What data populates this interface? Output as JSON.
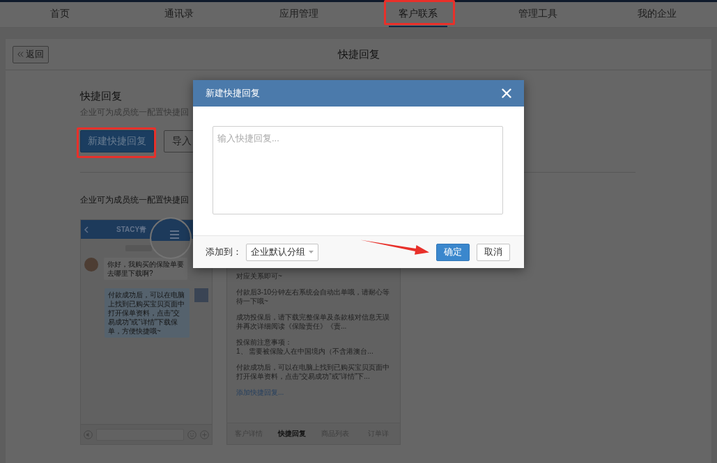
{
  "nav": {
    "items": [
      {
        "label": "首页",
        "selected": false,
        "marked": false
      },
      {
        "label": "通讯录",
        "selected": false,
        "marked": false
      },
      {
        "label": "应用管理",
        "selected": false,
        "marked": false
      },
      {
        "label": "客户联系",
        "selected": true,
        "marked": true
      },
      {
        "label": "管理工具",
        "selected": false,
        "marked": false
      },
      {
        "label": "我的企业",
        "selected": false,
        "marked": false
      }
    ]
  },
  "header": {
    "back_button": "返回",
    "title": "快捷回复"
  },
  "content": {
    "heading": "快捷回复",
    "description": "企业可为成员统一配置快捷回",
    "buttons": [
      {
        "label": "新建快捷回复",
        "kind": "primary",
        "marked": true
      },
      {
        "label": "导入",
        "kind": "default",
        "marked": false
      }
    ],
    "caption": "企业可为成员统一配置快捷回"
  },
  "chat_preview": {
    "title": "STACY青",
    "messages": [
      {
        "kind": "received",
        "text": "你好，我购买的保险单要去哪里下载啊?"
      },
      {
        "kind": "sent",
        "text": "付款成功后，可以在电脑上找到已购买宝贝页面中打开保单资料，点击“交易成功”或“详情”下载保单，方便快捷哦~"
      }
    ]
  },
  "reply_preview": {
    "items": [
      [
        "对应关系即可~"
      ],
      [
        "付款后3-10分钟左右系统会自动出单哦，请耐心等待一下哦~"
      ],
      [
        "成功投保后，请下载完整保单及条款核对信息无误并再次详细阅读《保险责任》《责..."
      ],
      [
        "投保前注意事项：",
        "1、 需要被保险人在中国境内（不含港澳台..."
      ],
      [
        "付款成功后，可以在电脑上找到已购买宝贝页面中打开保单资料，点击“交易成功”或“详情”下..."
      ]
    ],
    "add_link": "添加快捷回复...",
    "tabs": [
      {
        "label": "客户详情",
        "selected": false
      },
      {
        "label": "快捷回复",
        "selected": true
      },
      {
        "label": "商品列表",
        "selected": false
      },
      {
        "label": "订单详",
        "selected": false
      }
    ]
  },
  "dialog": {
    "title": "新建快捷回复",
    "placeholder": "输入快捷回复...",
    "add_to_label": "添加到：",
    "group": "企业默认分组",
    "buttons": [
      {
        "label": "确定",
        "kind": "primary",
        "arrow": true
      },
      {
        "label": "取消",
        "kind": "default",
        "arrow": false
      }
    ]
  }
}
